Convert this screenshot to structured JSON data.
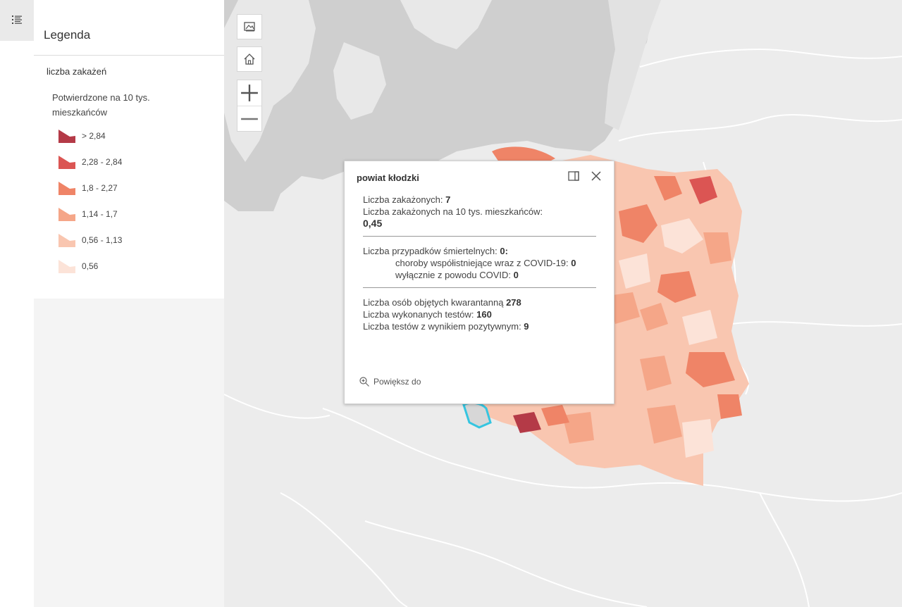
{
  "toolbar": {
    "legend_toggle_icon": "legend-list-icon"
  },
  "legend": {
    "title": "Legenda",
    "layer_name": "liczba zakażeń",
    "field_description": "Potwierdzone na 10 tys. mieszkańców",
    "classes": [
      {
        "label": "> 2,84",
        "color": "#b43a47"
      },
      {
        "label": "2,28 - 2,84",
        "color": "#db5553"
      },
      {
        "label": "1,8 - 2,27",
        "color": "#ef8467"
      },
      {
        "label": "1,14 - 1,7",
        "color": "#f5a688"
      },
      {
        "label": "0,56 - 1,13",
        "color": "#f9c6b0"
      },
      {
        "label": "0,56",
        "color": "#fce3d8"
      }
    ]
  },
  "map_widgets": {
    "basemap_icon": "basemap-gallery-icon",
    "home_icon": "home-icon",
    "zoom_in_label": "+",
    "zoom_out_label": "−"
  },
  "popup": {
    "title": "powiat kłodzki",
    "line1_label": "Liczba zakażonych: ",
    "line1_value": "7",
    "line2_label": "Liczba zakażonych na 10 tys. mieszkańców:",
    "line2_value": "0,45",
    "deaths_label": "Liczba przypadków śmiertelnych: ",
    "deaths_value": "0:",
    "comorbid_label": "choroby współistniejące wraz z COVID-19: ",
    "comorbid_value": "0",
    "covid_only_label": "wyłącznie z powodu COVID: ",
    "covid_only_value": "0",
    "quarantine_label": "Liczba osób objętych kwarantanną ",
    "quarantine_value": "278",
    "tests_label": "Liczba wykonanych testów: ",
    "tests_value": "160",
    "positive_label": "Liczba testów z wynikiem pozytywnym: ",
    "positive_value": "9",
    "zoom_to_label": "Powiększ do",
    "selected_outline_color": "#35c5e0"
  }
}
